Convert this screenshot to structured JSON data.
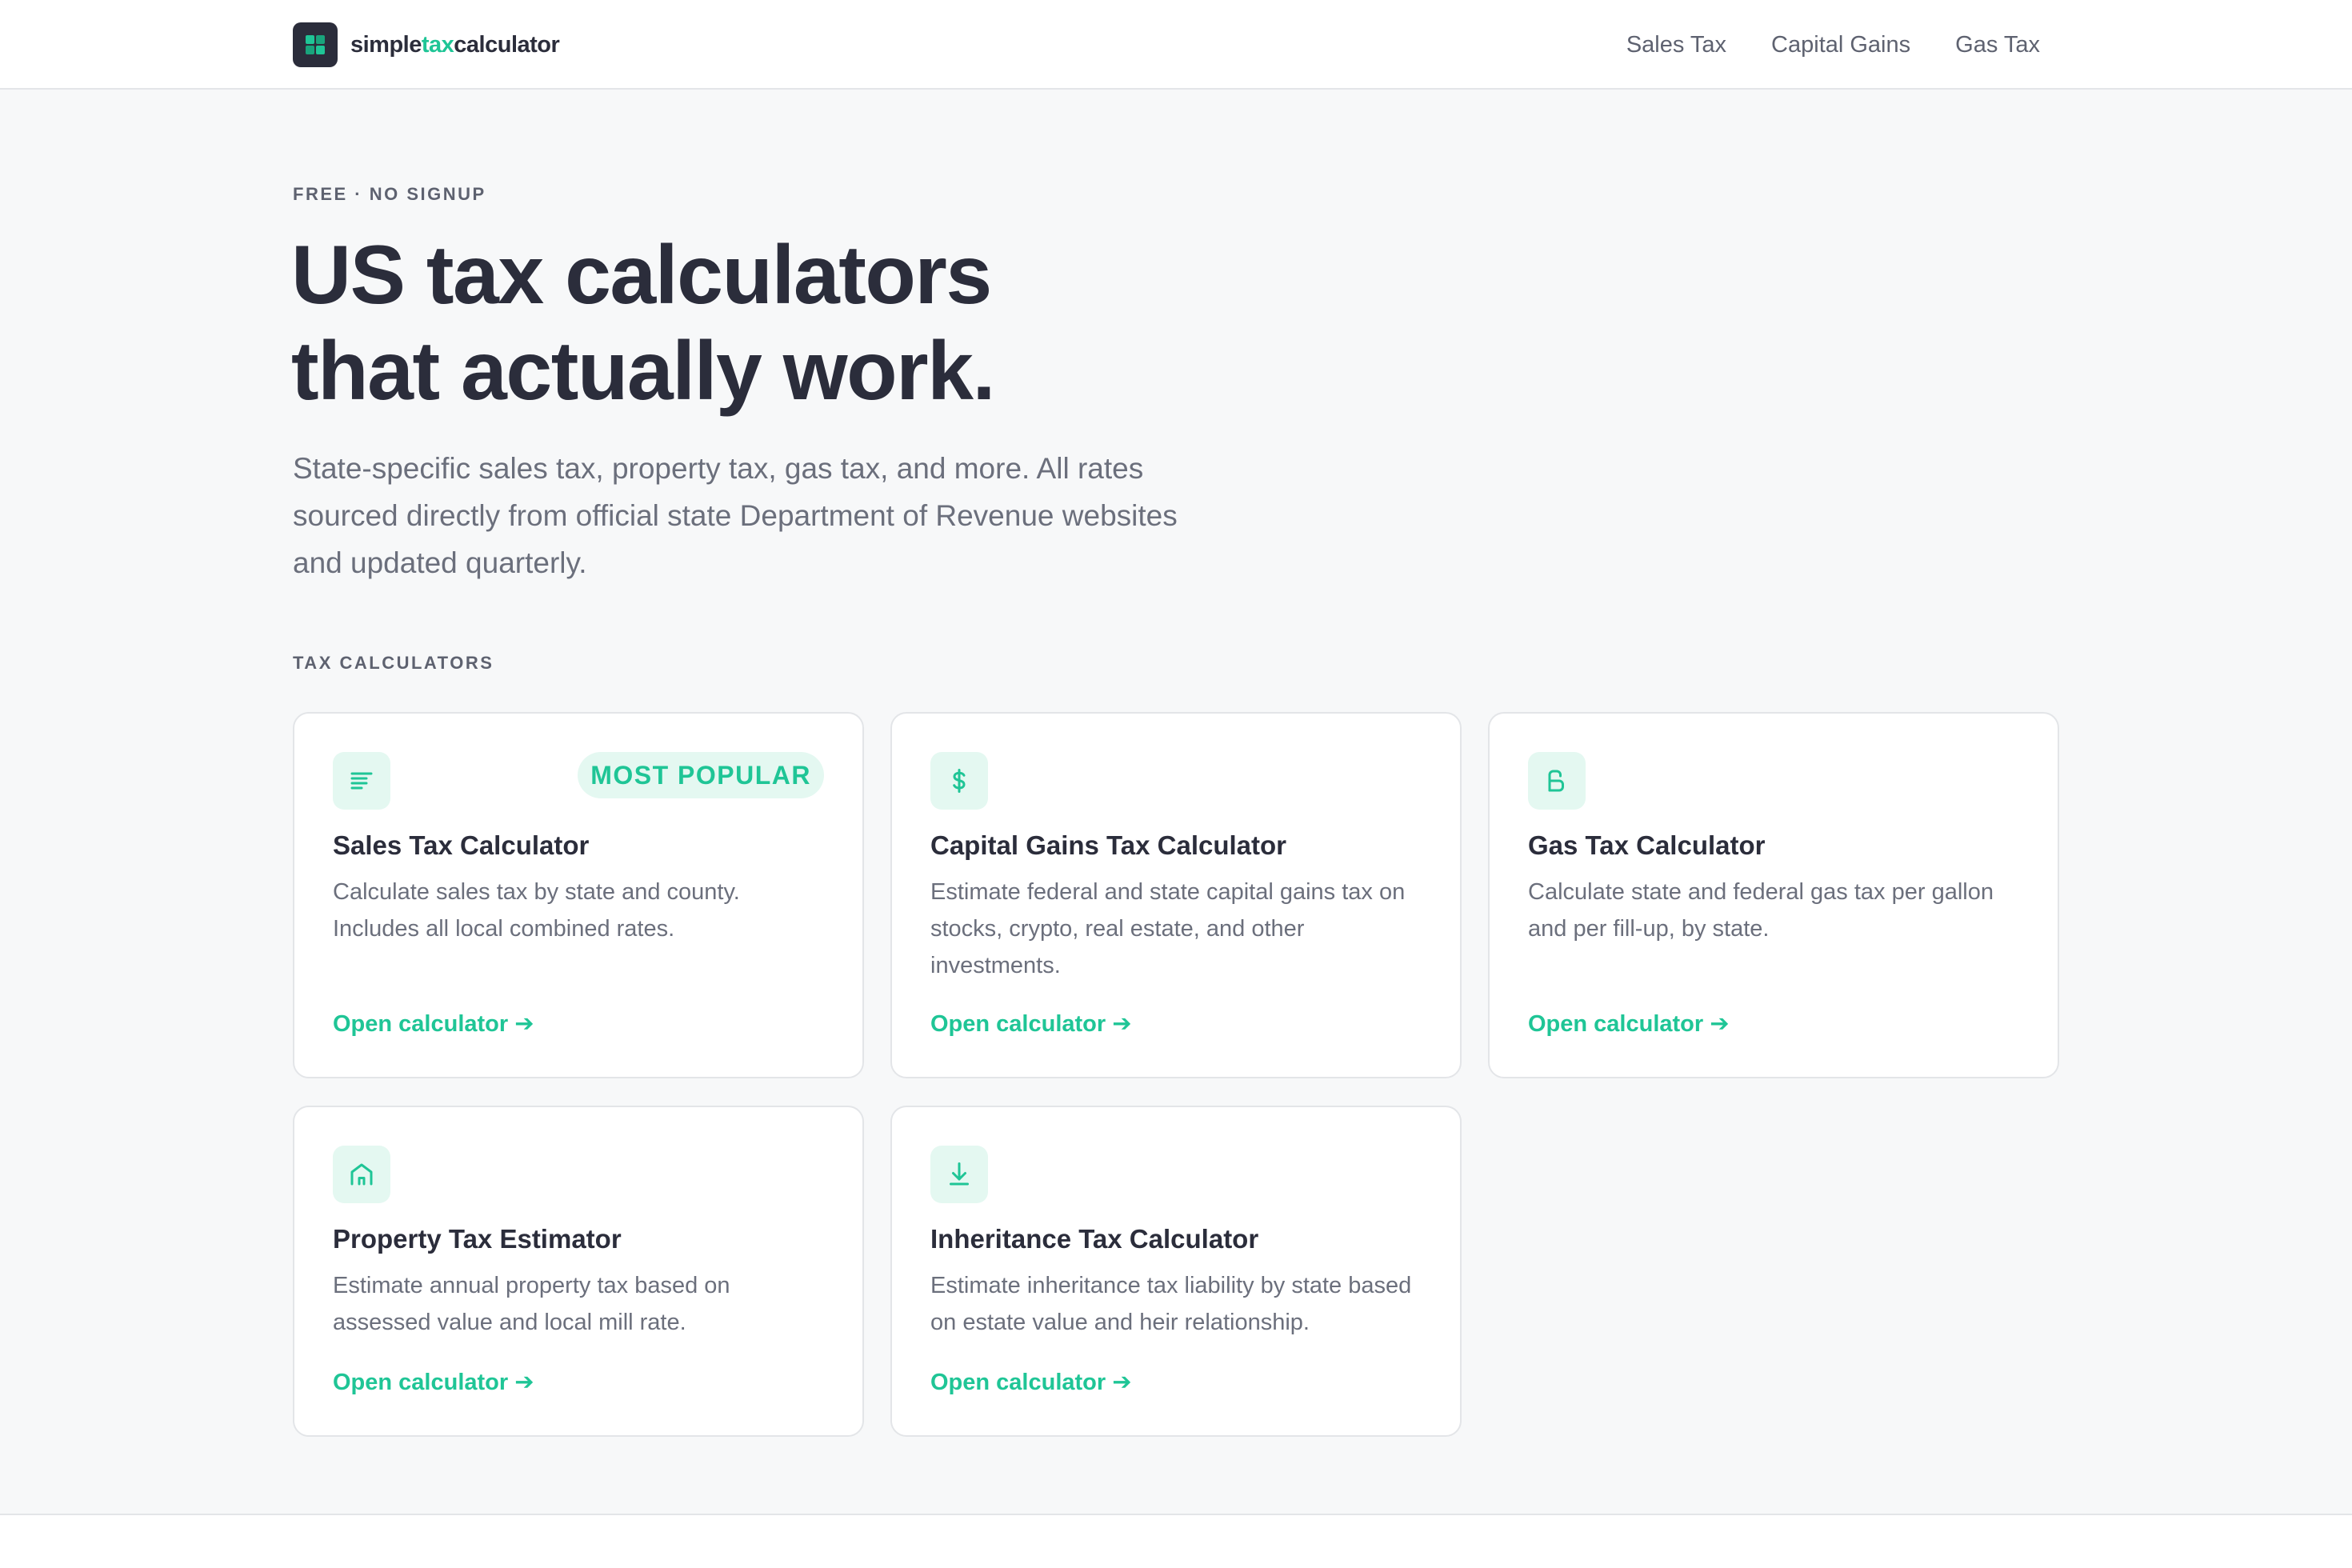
{
  "brand": {
    "prefix": "simple",
    "accent": "tax",
    "suffix": "calculator"
  },
  "nav": [
    {
      "label": "Sales Tax"
    },
    {
      "label": "Capital Gains"
    },
    {
      "label": "Gas Tax"
    }
  ],
  "hero": {
    "eyebrow": "FREE · NO SIGNUP",
    "title_line1": "US tax calculators",
    "title_line2": "that actually work.",
    "subtitle": "State-specific sales tax, property tax, gas tax, and more. All rates sourced directly from official state Department of Revenue websites and updated quarterly."
  },
  "section": {
    "label": "TAX CALCULATORS"
  },
  "cards": [
    {
      "icon": "document-lines-icon",
      "badge": "MOST POPULAR",
      "title": "Sales Tax Calculator",
      "description": "Calculate sales tax by state and county. Includes all local combined rates.",
      "link": "Open calculator ➔"
    },
    {
      "icon": "dollar-icon",
      "title": "Capital Gains Tax Calculator",
      "description": "Estimate federal and state capital gains tax on stocks, crypto, real estate, and other investments.",
      "link": "Open calculator ➔"
    },
    {
      "icon": "gas-pump-icon",
      "title": "Gas Tax Calculator",
      "description": "Calculate state and federal gas tax per gallon and per fill-up, by state.",
      "link": "Open calculator ➔"
    },
    {
      "icon": "house-icon",
      "title": "Property Tax Estimator",
      "description": "Estimate annual property tax based on assessed value and local mill rate.",
      "link": "Open calculator ➔"
    },
    {
      "icon": "download-icon",
      "title": "Inheritance Tax Calculator",
      "description": "Estimate inheritance tax liability by state based on estate value and heir relationship.",
      "link": "Open calculator ➔"
    }
  ],
  "colors": {
    "accent": "#1fc596",
    "accent_soft": "#e4f8f1",
    "text_dark": "#2b2d3b",
    "text_muted": "#6b6f7c",
    "background": "#f7f8f9",
    "border": "#e3e5e8"
  }
}
